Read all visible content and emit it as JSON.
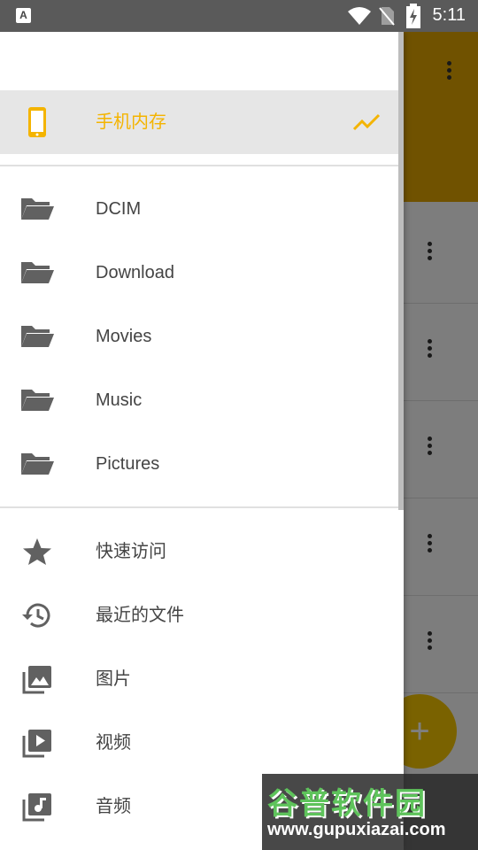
{
  "status_bar": {
    "time": "5:11",
    "notification": "A"
  },
  "drawer": {
    "storage": {
      "label": "手机内存"
    },
    "folders": [
      {
        "label": "DCIM"
      },
      {
        "label": "Download"
      },
      {
        "label": "Movies"
      },
      {
        "label": "Music"
      },
      {
        "label": "Pictures"
      }
    ],
    "quick": [
      {
        "label": "快速访问",
        "icon": "star-icon"
      },
      {
        "label": "最近的文件",
        "icon": "history-icon"
      },
      {
        "label": "图片",
        "icon": "image-icon"
      },
      {
        "label": "视频",
        "icon": "video-icon"
      },
      {
        "label": "音频",
        "icon": "audio-icon"
      }
    ]
  },
  "background": {
    "fab_label": "+"
  },
  "watermark": {
    "title": "谷普软件园",
    "url": "www.gupuxiazai.com"
  },
  "colors": {
    "accent": "#f4b400",
    "toolbar": "#e0a400"
  }
}
